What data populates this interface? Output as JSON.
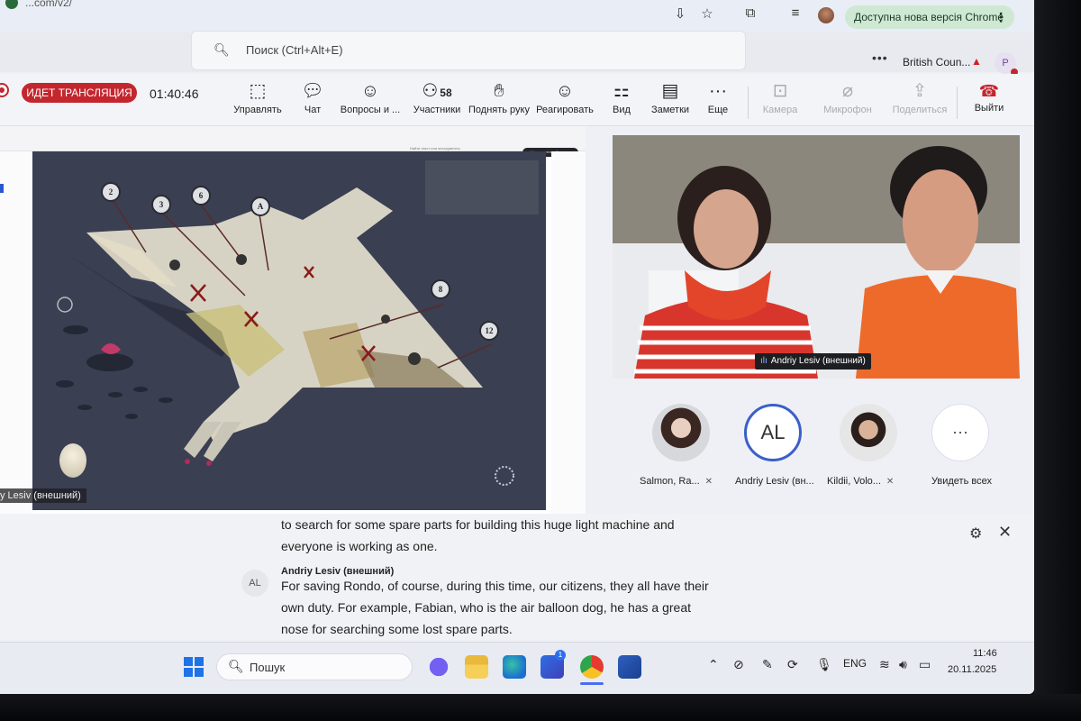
{
  "browser": {
    "url_fragment": "...com/v2/",
    "update_label": "Доступна нова версія Chrome",
    "colors": {
      "update_bg": "#cfe8d3"
    }
  },
  "teams_header": {
    "search_placeholder": "Поиск (Ctrl+Alt+E)",
    "org_name": "British Coun...",
    "avatar_initial": "P"
  },
  "meeting": {
    "live_label": "ИДЕТ ТРАНСЛЯЦИЯ",
    "timer": "01:40:46",
    "participant_count": "58",
    "toolbar": {
      "manage": "Управлять",
      "chat": "Чат",
      "qa": "Вопросы и ...",
      "people": "Участники",
      "raise": "Поднять руку",
      "react": "Реагировать",
      "view": "Вид",
      "notes": "Заметки",
      "more": "Еще",
      "camera": "Камера",
      "mic": "Микрофон",
      "share": "Поделиться",
      "leave": "Выйти"
    },
    "colors": {
      "live": "#c4262e",
      "accent": "#3a5fc8"
    }
  },
  "shared_screen": {
    "presenter_label": "y Lesiv (внешний)",
    "slide_numbers": [
      "2",
      "3",
      "6",
      "A",
      "8",
      "12"
    ],
    "find_label": "Найти текст или инструменты",
    "share_button": "Надати спільний доступ"
  },
  "video": {
    "speaker_label": "Andriy Lesiv (внешний)"
  },
  "roster": [
    {
      "name": "Salmon, Ra...",
      "initials": ""
    },
    {
      "name": "Andriy Lesiv (вн...",
      "initials": "AL"
    },
    {
      "name": "Kildii, Volo...",
      "initials": ""
    }
  ],
  "roster_more_label": "Увидеть всех",
  "captions": {
    "line1": "to search for some spare parts for building this huge light machine and",
    "line2": "everyone is working as one.",
    "speaker": "Andriy Lesiv (внешний)",
    "speaker_initials": "AL",
    "line3": "For saving Rondo, of course, during this time, our citizens, they all have their",
    "line4": "own duty. For example, Fabian, who is the air balloon dog, he has a great",
    "line5": "nose for searching some lost spare parts."
  },
  "taskbar": {
    "search_label": "Пошук",
    "store_badge": "1",
    "language": "ENG",
    "time": "11:46",
    "date": "20.11.2025"
  }
}
